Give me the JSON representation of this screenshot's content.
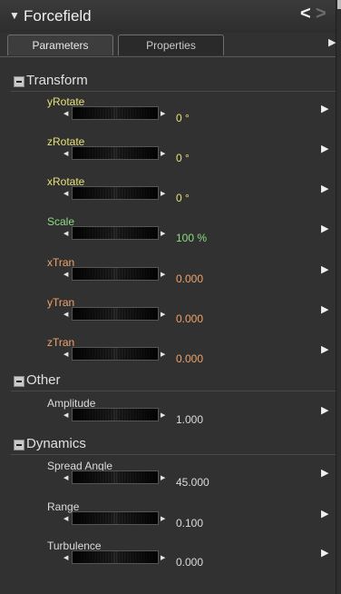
{
  "title": "Forcefield",
  "tabs": [
    {
      "label": "Parameters",
      "active": true
    },
    {
      "label": "Properties",
      "active": false
    }
  ],
  "groups": [
    {
      "name": "Transform",
      "params": [
        {
          "label": "yRotate",
          "value": "0 °",
          "color": "#e8e07a"
        },
        {
          "label": "zRotate",
          "value": "0 °",
          "color": "#e8e07a"
        },
        {
          "label": "xRotate",
          "value": "0 °",
          "color": "#e8e07a"
        },
        {
          "label": "Scale",
          "value": "100 %",
          "color": "#8edc82"
        },
        {
          "label": "xTran",
          "value": "0.000",
          "color": "#f0a36a"
        },
        {
          "label": "yTran",
          "value": "0.000",
          "color": "#f0a36a"
        },
        {
          "label": "zTran",
          "value": "0.000",
          "color": "#f0a36a"
        }
      ]
    },
    {
      "name": "Other",
      "params": [
        {
          "label": "Amplitude",
          "value": "1.000",
          "color": "#dcdcdc"
        }
      ]
    },
    {
      "name": "Dynamics",
      "params": [
        {
          "label": "Spread Angle",
          "value": "45.000",
          "color": "#dcdcdc"
        },
        {
          "label": "Range",
          "value": "0.100",
          "color": "#dcdcdc"
        },
        {
          "label": "Turbulence",
          "value": "0.000",
          "color": "#dcdcdc"
        }
      ]
    }
  ],
  "icons": {
    "collapse": "triangle-down-icon",
    "nav_prev": "chevron-left-icon",
    "nav_next": "chevron-right-icon",
    "row_menu": "triangle-right-icon",
    "dial": "dial-slider-icon"
  }
}
